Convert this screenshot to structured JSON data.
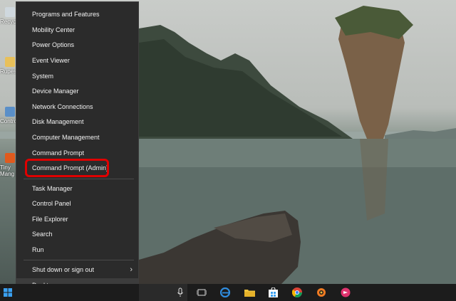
{
  "desktop": {
    "icons": [
      {
        "label": "Recycl",
        "icon": "recycle-bin-icon"
      },
      {
        "label": "Rupes",
        "icon": "folder-icon"
      },
      {
        "label": "Contro",
        "icon": "control-panel-icon"
      },
      {
        "label": "Tiny",
        "icon": "app-icon"
      },
      {
        "label": "Mang",
        "icon": "app-icon"
      }
    ]
  },
  "winx_menu": {
    "items": [
      "Programs and Features",
      "Mobility Center",
      "Power Options",
      "Event Viewer",
      "System",
      "Device Manager",
      "Network Connections",
      "Disk Management",
      "Computer Management",
      "Command Prompt",
      "Command Prompt (Admin)",
      "Task Manager",
      "Control Panel",
      "File Explorer",
      "Search",
      "Run",
      "Shut down or sign out",
      "Desktop"
    ],
    "highlighted_item": "Command Prompt (Admin)",
    "highlight_color": "#e00000"
  },
  "taskbar": {
    "icons": [
      "windows-start-icon",
      "microphone-icon",
      "task-view-icon",
      "edge-icon",
      "file-explorer-icon",
      "store-icon",
      "chrome-icon",
      "app-icon",
      "app-icon"
    ]
  }
}
